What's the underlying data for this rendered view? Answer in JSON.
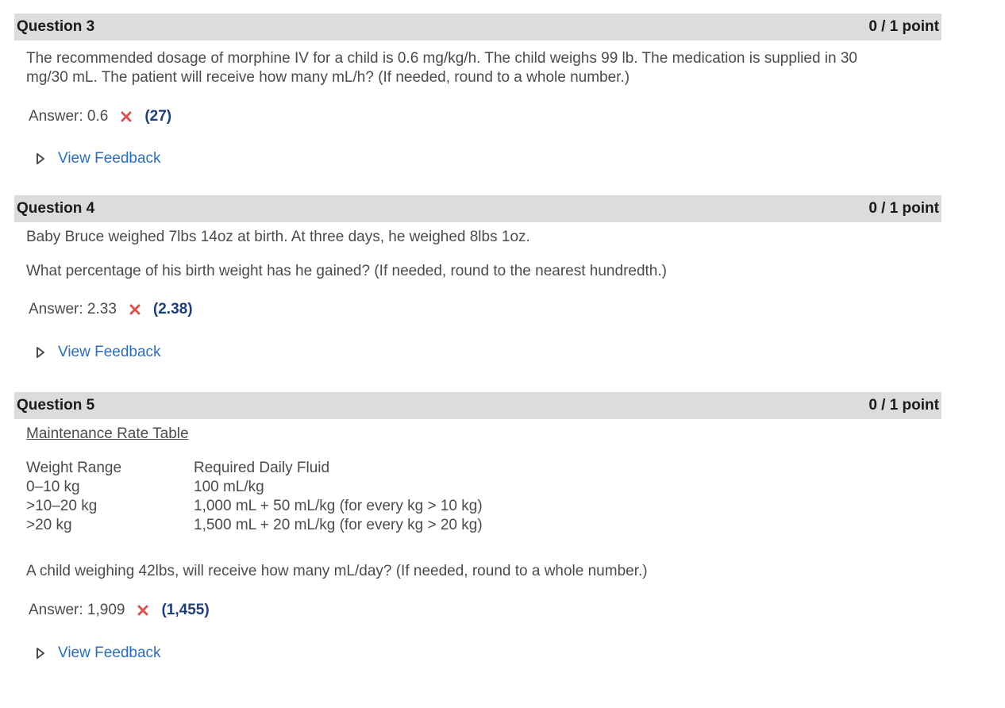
{
  "questions": [
    {
      "title": "Question 3",
      "points": "0 / 1 point",
      "text": [
        "The recommended dosage of morphine IV for a child is 0.6 mg/kg/h. The child weighs 99 lb. The medication is supplied in 30",
        "mg/30 mL.  The patient will receive how many mL/h?  (If needed, round to a whole number.)"
      ],
      "answer_label": "Answer: 0.6",
      "correct_answer": "(27)",
      "status_icon": "x-mark-icon",
      "feedback_label": "View Feedback"
    },
    {
      "title": "Question 4",
      "points": "0 / 1 point",
      "text": [
        "Baby Bruce weighed 7lbs 14oz at birth.  At three days, he weighed 8lbs 1oz.",
        "What percentage of his birth weight has he gained?  (If needed, round to the nearest hundredth.)"
      ],
      "answer_label": "Answer: 2.33",
      "correct_answer": "(2.38)",
      "status_icon": "x-mark-icon",
      "feedback_label": "View Feedback"
    },
    {
      "title": "Question 5",
      "points": "0 / 1 point",
      "table_title": "Maintenance Rate Table",
      "table": {
        "headers": [
          "Weight Range",
          "Required Daily Fluid"
        ],
        "rows": [
          [
            "0–10 kg",
            "100 mL/kg"
          ],
          [
            ">10–20 kg",
            "1,000 mL + 50 mL/kg (for every kg > 10 kg)"
          ],
          [
            ">20 kg",
            "1,500 mL + 20 mL/kg (for every kg > 20 kg)"
          ]
        ]
      },
      "text": [
        "A child weighing 42lbs, will receive how many mL/day?  (If needed, round to a whole number.)"
      ],
      "answer_label": "Answer: 1,909",
      "correct_answer": "(1,455)",
      "status_icon": "x-mark-icon",
      "feedback_label": "View Feedback"
    }
  ],
  "colors": {
    "header_bg": "#dcdcdc",
    "incorrect": "#d9534f",
    "correct_answer": "#1e3f7a",
    "link": "#2a6ebb"
  }
}
